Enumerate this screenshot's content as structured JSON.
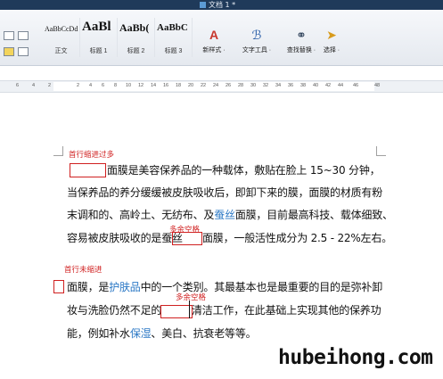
{
  "window": {
    "title": "文档 1 *"
  },
  "ribbon": {
    "styles": [
      {
        "sample": "AaBbCcDd",
        "label": "正文"
      },
      {
        "sample": "AaBl",
        "label": "标题 1"
      },
      {
        "sample": "AaBb(",
        "label": "标题 2"
      },
      {
        "sample": "AaBbC",
        "label": "标题 3"
      }
    ],
    "tools": {
      "new_style": "新样式 ·",
      "text_tools": "文字工具 ·",
      "find_replace": "查找替换 ·",
      "select": "选择 ·"
    },
    "icons": {
      "new_style": "new-style-icon",
      "text_tools": "text-tools-icon",
      "find_replace": "binoculars-icon",
      "select": "cursor-arrow-icon"
    }
  },
  "ruler": {
    "ticks": [
      "6",
      "4",
      "2",
      "",
      "2",
      "4",
      "6",
      "8",
      "10",
      "12",
      "14",
      "16",
      "18",
      "20",
      "22",
      "24",
      "26",
      "28",
      "30",
      "32",
      "34",
      "36",
      "38",
      "40",
      "42",
      "44",
      "46",
      "48"
    ]
  },
  "document": {
    "annotations": {
      "indent_too_much": "首行缩进过多",
      "extra_space_1": "多余空格",
      "no_indent": "首行未缩进",
      "extra_space_2": "多余空格"
    },
    "p1": {
      "l1": "面膜是美容保养品的一种载体，敷贴在脸上 15~30 分钟，",
      "l2": "当保养品的养分缓缓被皮肤吸收后，即卸下来的膜，面膜的材质有粉",
      "l3a": "末调和的、高岭土、无纺布、及",
      "l3link": "蚕丝",
      "l3b": "面膜，目前最高科技、载体细致、",
      "l4a": "容易被皮肤吸收的是蚕丝",
      "l4b": "面膜，一般活性成分为 2.5 - 22%左右。"
    },
    "p2": {
      "l1a": "面膜，是",
      "l1link": "护肤品",
      "l1b": "中的一个类别。其最基本也是最重要的目的是弥补卸",
      "l2a": "妆与洗脸仍然不足的",
      "l2b": "清洁工作，在此基础上实现其他的保养功",
      "l3a": "能，例如补水",
      "l3link": "保湿",
      "l3b": "、美白、抗衰老等等。"
    },
    "watermark": "hubeihong.com"
  },
  "colors": {
    "annotation": "#d02020",
    "link": "#2b78c5",
    "titlebar": "#1f3a5a"
  }
}
